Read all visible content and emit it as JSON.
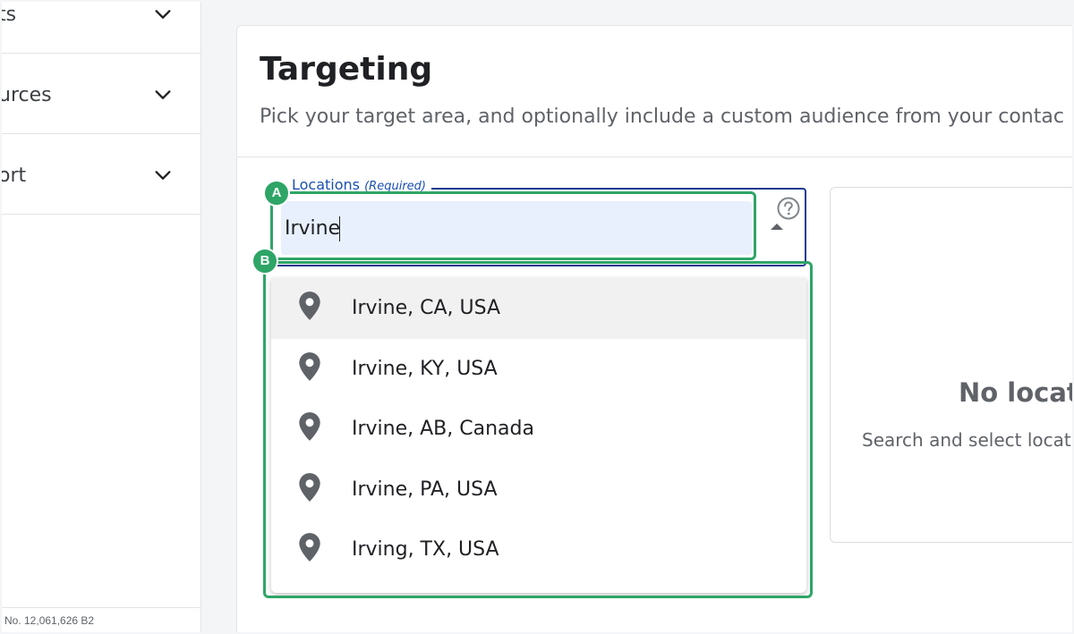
{
  "sidebar": {
    "items": [
      {
        "label": "ts"
      },
      {
        "label": "urces"
      },
      {
        "label": "ort"
      }
    ],
    "patent": "No. 12,061,626 B2"
  },
  "targeting": {
    "title": "Targeting",
    "subtitle": "Pick your target area, and optionally include a custom audience from your contac",
    "locations_label": "Locations",
    "required_label": "(Required)",
    "input_value": "Irvine",
    "options": [
      {
        "label": "Irvine, CA, USA"
      },
      {
        "label": "Irvine, KY, USA"
      },
      {
        "label": "Irvine, AB, Canada"
      },
      {
        "label": "Irvine, PA, USA"
      },
      {
        "label": "Irving, TX, USA"
      }
    ]
  },
  "empty_state": {
    "title": "No locati",
    "subtitle": "Search and select locati"
  },
  "annotations": {
    "a": "A",
    "b": "B"
  },
  "colors": {
    "accent_green": "#2ea566",
    "field_border": "#1a3a8f",
    "input_bg": "#e8f0fe"
  }
}
